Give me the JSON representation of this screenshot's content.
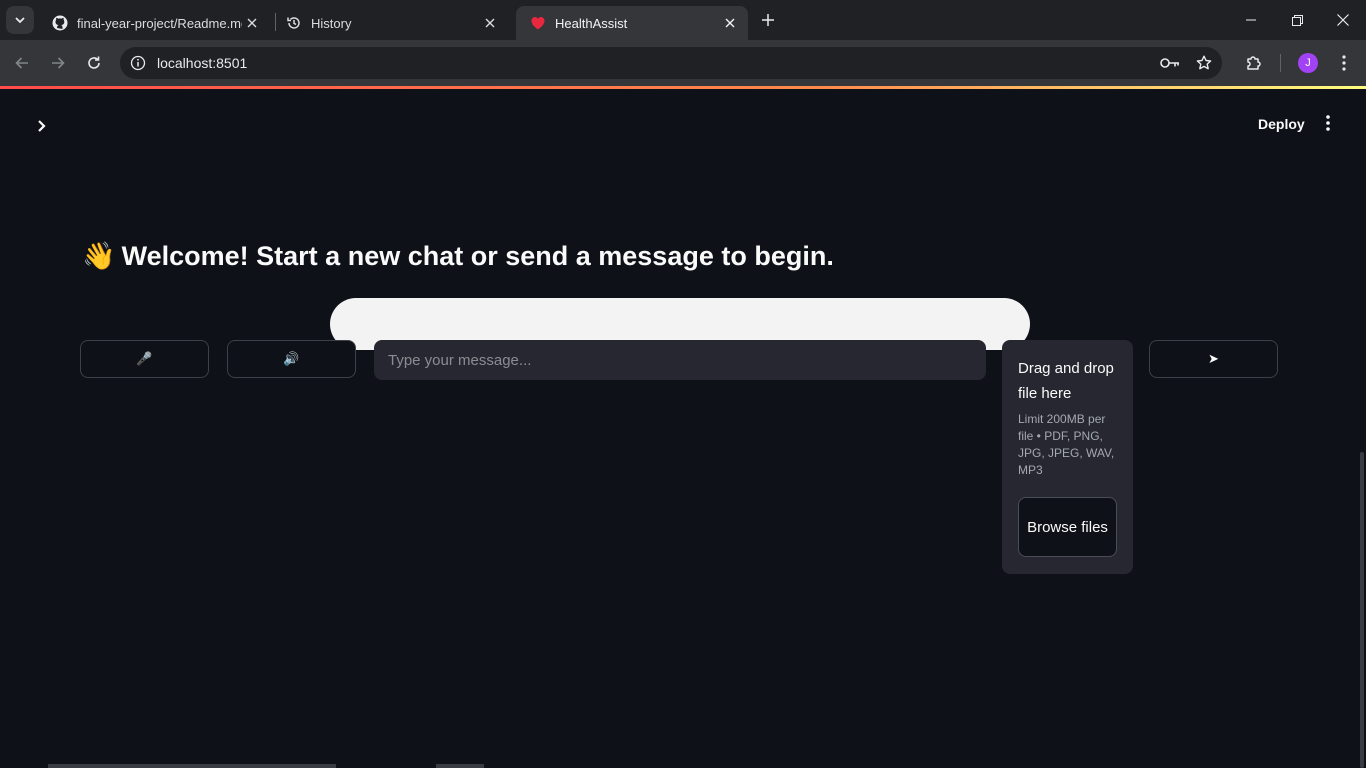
{
  "browser": {
    "tabs": [
      {
        "title": "final-year-project/Readme.md at main",
        "favicon": "github-icon",
        "active": false
      },
      {
        "title": "History",
        "favicon": "history-icon",
        "active": false
      },
      {
        "title": "HealthAssist",
        "favicon": "heart-icon",
        "active": true
      }
    ],
    "url": "localhost:8501",
    "profile_initial": "J"
  },
  "header": {
    "deploy_label": "Deploy"
  },
  "main": {
    "welcome_emoji": "👋",
    "welcome_text": "Welcome! Start a new chat or send a message to begin.",
    "mic_button": "🎤",
    "speaker_button": "🔊",
    "message_placeholder": "Type your message...",
    "send_button": "➤"
  },
  "uploader": {
    "title": "Drag and drop file here",
    "limit": "Limit 200MB per file • PDF, PNG, JPG, JPEG, WAV, MP3",
    "browse_label": "Browse files"
  },
  "colors": {
    "app_background": "#0e1117",
    "input_background": "#262730",
    "tab_strip": "#202124",
    "toolbar": "#35363a",
    "accent_gradient_start": "#ff4b4b",
    "accent_gradient_end": "#fffd80"
  }
}
